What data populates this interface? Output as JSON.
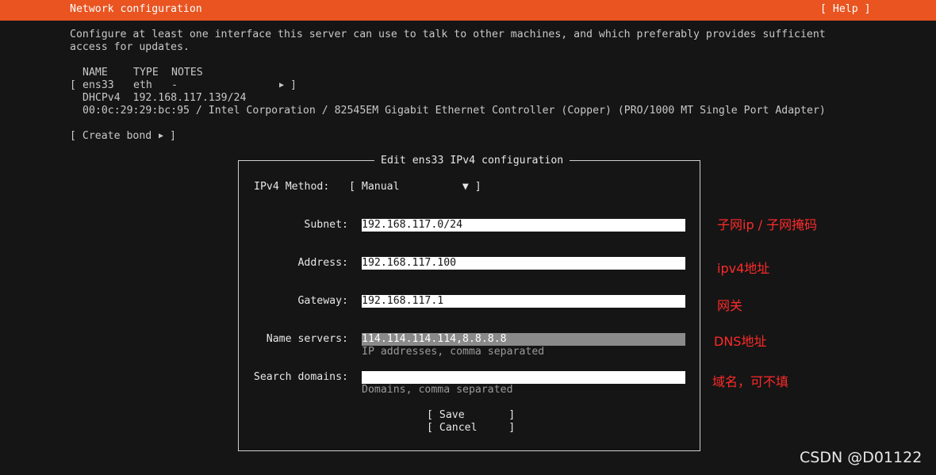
{
  "header": {
    "title": "Network configuration",
    "help_label": "[ Help ]",
    "color": "#e95420"
  },
  "intro": {
    "line1": "Configure at least one interface this server can use to talk to other machines, and which preferably provides sufficient",
    "line2": "access for updates."
  },
  "interfaces": {
    "columns": [
      "NAME",
      "TYPE",
      "NOTES"
    ],
    "row": {
      "bracket_open": "[",
      "name": "ens33",
      "type": "eth",
      "notes": "-",
      "arrow": "▶",
      "bracket_close": "]"
    },
    "dhcp": "DHCPv4  192.168.117.139/24",
    "device": "00:0c:29:29:bc:95 / Intel Corporation / 82545EM Gigabit Ethernet Controller (Copper) (PRO/1000 MT Single Port Adapter)"
  },
  "create_bond": {
    "label": "[ Create bond",
    "arrow": "▶",
    "close": "]"
  },
  "dialog": {
    "title": "Edit ens33 IPv4 configuration",
    "method_label": "IPv4 Method:",
    "method_value": "[ Manual          ▼ ]",
    "subnet_label": "Subnet:",
    "subnet_value": "192.168.117.0/24",
    "address_label": "Address:",
    "address_value": "192.168.117.100",
    "gateway_label": "Gateway:",
    "gateway_value": "192.168.117.1",
    "nameservers_label": "Name servers:",
    "nameservers_value": "114.114.114.114,8.8.8.8",
    "nameservers_hint": "IP addresses, comma separated",
    "search_label": "Search domains:",
    "search_value": "",
    "search_hint": "Domains, comma separated",
    "save_label": "[ Save       ]",
    "cancel_label": "[ Cancel     ]"
  },
  "annotations": {
    "subnet": "子网ip / 子网掩码",
    "address": "ipv4地址",
    "gateway": "网关",
    "dns": "DNS地址",
    "search": "域名，可不填",
    "color": "#ff2a2a"
  },
  "watermark": "CSDN @D01122"
}
